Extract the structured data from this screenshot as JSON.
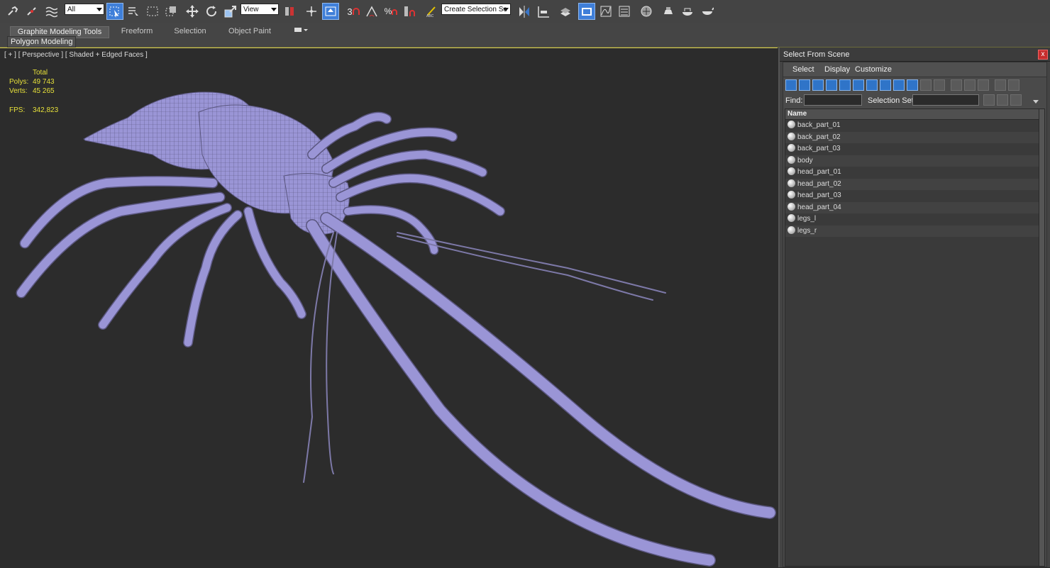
{
  "toolbar": {
    "selection_filter": "All",
    "reference_coord": "View",
    "named_selection_placeholder": "Create Selection Se",
    "snaps_angle_label": "3",
    "percent_snap_label": "%"
  },
  "ribbon": {
    "tabs": [
      "Graphite Modeling Tools",
      "Freeform",
      "Selection",
      "Object Paint"
    ],
    "active_tab": "Graphite Modeling Tools",
    "panel_label": "Polygon Modeling"
  },
  "viewport": {
    "label": "[ + ] [ Perspective ] [ Shaded + Edged Faces ]",
    "stats": {
      "total_label": "Total",
      "polys_label": "Polys:",
      "polys_value": "49 743",
      "verts_label": "Verts:",
      "verts_value": "45 265",
      "fps_label": "FPS:",
      "fps_value": "342,823"
    },
    "mesh_color": "#9a95d6",
    "wire_color": "#5a567f"
  },
  "panel": {
    "title": "Select From Scene",
    "close_label": "x",
    "menu": [
      "Select",
      "Display",
      "Customize"
    ],
    "find_label": "Find:",
    "selection_set_label": "Selection Set:",
    "column_name": "Name",
    "objects": [
      "back_part_01",
      "back_part_02",
      "back_part_03",
      "body",
      "head_part_01",
      "head_part_02",
      "head_part_03",
      "head_part_04",
      "legs_l",
      "legs_r"
    ]
  },
  "colors": {
    "accent_blue": "#3f7fd9",
    "stat_yellow": "#e6e03a",
    "viewport_border": "#d4c95a"
  }
}
